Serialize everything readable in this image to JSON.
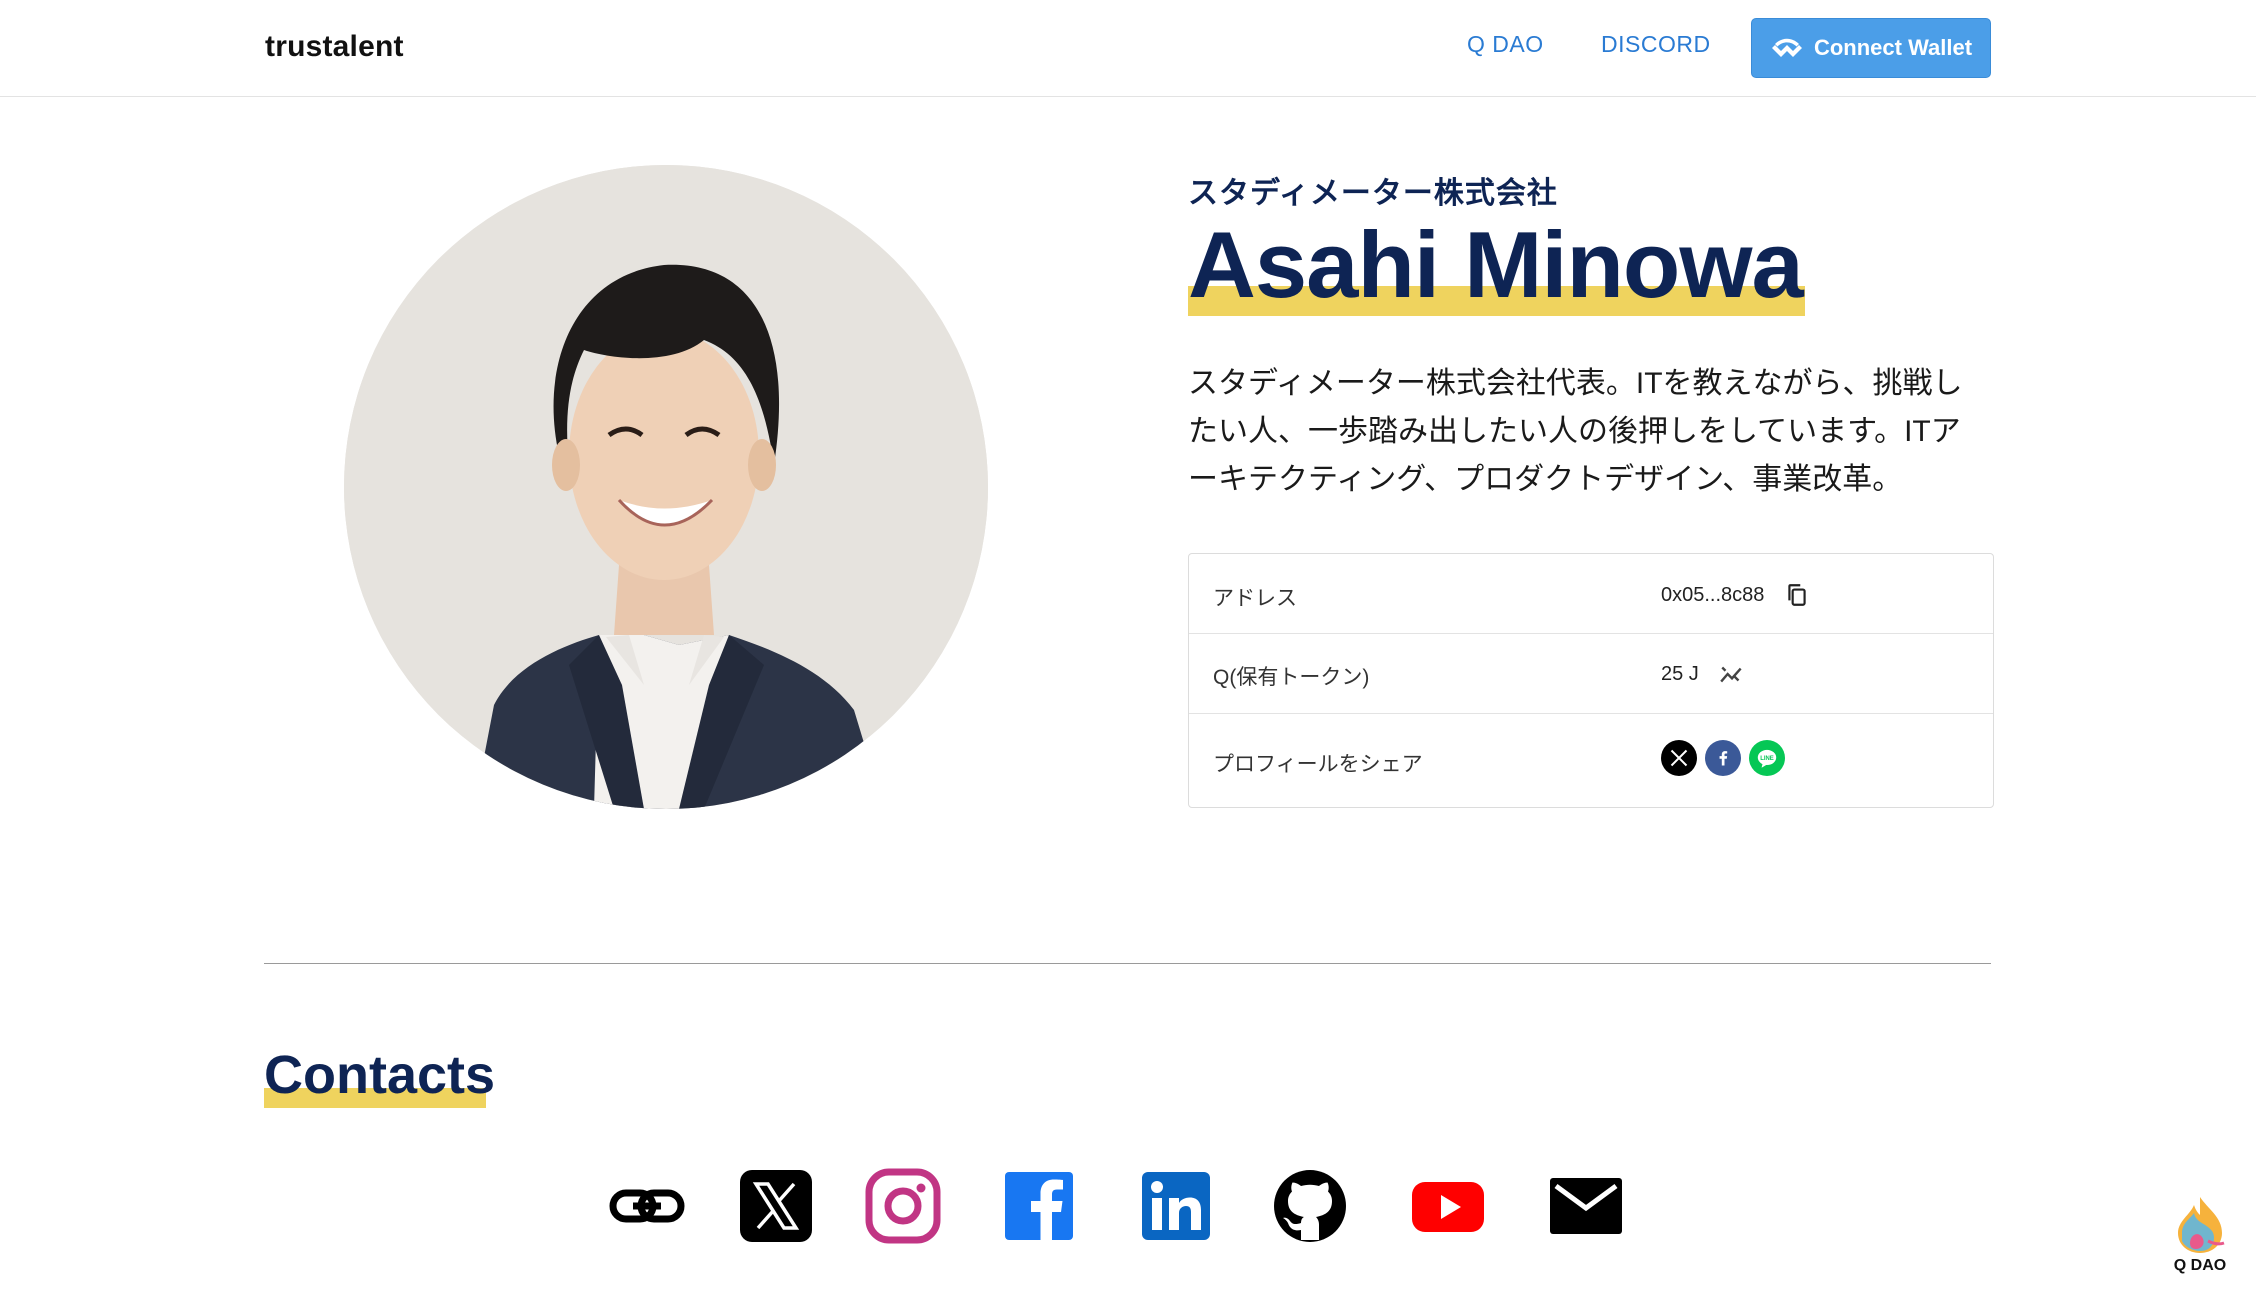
{
  "header": {
    "brand": "trustalent",
    "nav": [
      {
        "label": "Q DAO"
      },
      {
        "label": "DISCORD"
      }
    ],
    "connect_wallet": "Connect Wallet"
  },
  "profile": {
    "company": "スタディメーター株式会社",
    "name": "Asahi Minowa",
    "bio": "スタディメーター株式会社代表。ITを教えながら、挑戦したい人、一歩踏み出したい人の後押しをしています。ITアーキテクティング、プロダクトデザイン、事業改革。"
  },
  "info": {
    "address_label": "アドレス",
    "address_value": "0x05...8c88",
    "token_label": "Q(保有トークン)",
    "token_value": "25 J",
    "share_label": "プロフィールをシェア"
  },
  "contacts": {
    "title": "Contacts",
    "items": [
      "link-icon",
      "x-icon",
      "instagram-icon",
      "facebook-icon",
      "linkedin-icon",
      "github-icon",
      "youtube-icon",
      "mail-icon"
    ]
  },
  "badge": {
    "label": "Q DAO"
  },
  "colors": {
    "navy": "#0e2454",
    "highlight": "#efd35e",
    "link_blue": "#2a7bd3",
    "button_blue": "#4b9ee8"
  }
}
